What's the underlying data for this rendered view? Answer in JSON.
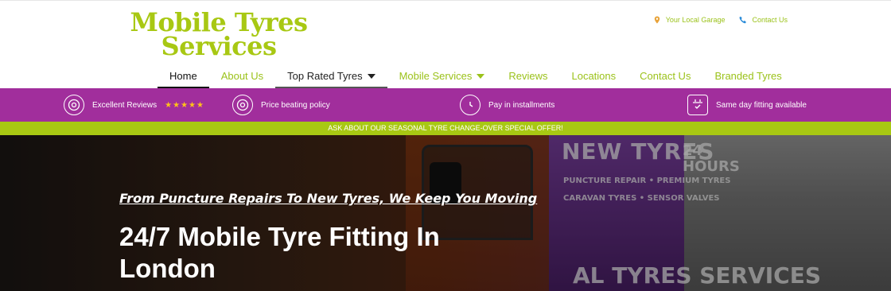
{
  "brand": {
    "line1": "Mobile Tyres",
    "line2": "Services",
    "color": "#a8c813"
  },
  "top_links": [
    {
      "icon": "map-pin-icon",
      "label": "Your Local Garage"
    },
    {
      "icon": "phone-icon",
      "label": "Contact Us"
    }
  ],
  "nav": [
    {
      "label": "Home",
      "active": true
    },
    {
      "label": "About Us"
    },
    {
      "label": "Top Rated Tyres",
      "dropdown": true
    },
    {
      "label": "Mobile Services",
      "dropdown": true
    },
    {
      "label": "Reviews"
    },
    {
      "label": "Locations"
    },
    {
      "label": "Contact Us"
    },
    {
      "label": "Branded Tyres"
    }
  ],
  "features": [
    {
      "icon": "tyre-icon",
      "label": "Excellent Reviews",
      "stars": "★★★★★"
    },
    {
      "icon": "tyre-icon",
      "label": "Price beating policy"
    },
    {
      "icon": "clock-icon",
      "label": "Pay in installments"
    },
    {
      "icon": "calendar-check-icon",
      "label": "Same day fitting available"
    }
  ],
  "promo": "ASK ABOUT OUR SEASONAL TYRE CHANGE-OVER SPECIAL OFFER!",
  "hero": {
    "subtitle": "From Puncture Repairs To New Tyres, We Keep You Moving",
    "title": "24/7 Mobile Tyre Fitting In London",
    "van_text_main": "NEW TYRES",
    "van_text_1": "PUNCTURE REPAIR • PREMIUM TYRES",
    "van_text_2": "CARAVAN TYRES • SENSOR VALVES",
    "van_text_hours": "24 HOURS",
    "van_text_bottom": "AL TYRES SERVICES"
  },
  "colors": {
    "accent_green": "#a8c813",
    "purple": "#a12e9c",
    "star": "#ffc21a"
  }
}
